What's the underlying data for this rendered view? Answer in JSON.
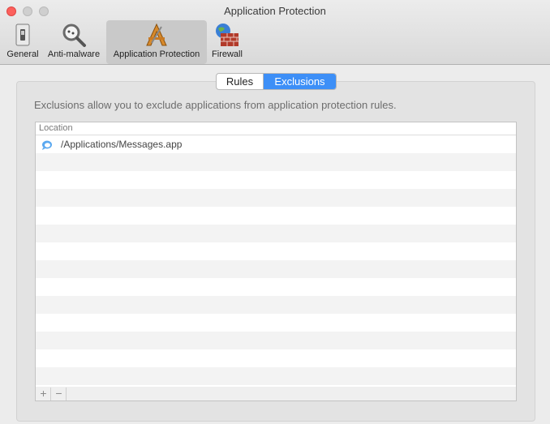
{
  "window": {
    "title": "Application Protection"
  },
  "toolbar": {
    "items": [
      {
        "label": "General",
        "icon": "switch-icon"
      },
      {
        "label": "Anti-malware",
        "icon": "magnifier-icon"
      },
      {
        "label": "Application Protection",
        "icon": "app-store-icon"
      },
      {
        "label": "Firewall",
        "icon": "firewall-icon"
      }
    ],
    "selected": "Application Protection"
  },
  "tabs": {
    "rules": "Rules",
    "exclusions": "Exclusions",
    "active": "Exclusions"
  },
  "description": "Exclusions allow you to exclude applications from application protection rules.",
  "table": {
    "header": "Location",
    "rows": [
      {
        "path": "/Applications/Messages.app",
        "icon": "messages-icon"
      }
    ]
  },
  "footer": {
    "add": "+",
    "remove": "−"
  },
  "colors": {
    "accent": "#3d8ff7",
    "close": "#fc605c"
  }
}
